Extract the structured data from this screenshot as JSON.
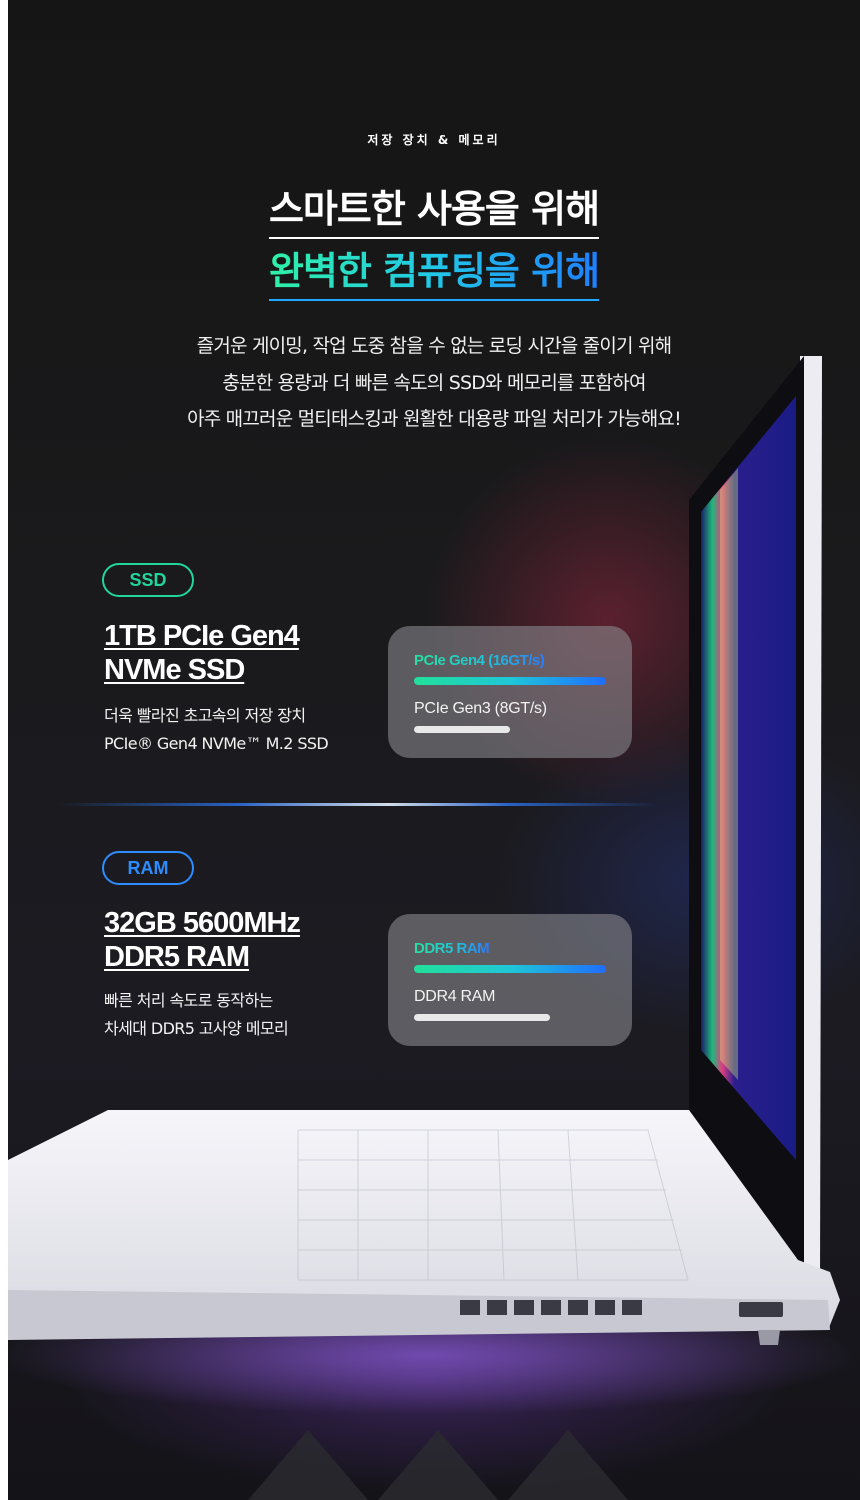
{
  "header": {
    "eyebrow": "저장 장치 & 메모리",
    "title_line1": "스마트한 사용을 위해",
    "title_line2": "완벽한 컴퓨팅을 위해"
  },
  "description": {
    "line1": "즐거운 게이밍, 작업 도중 참을 수 없는 로딩 시간을 줄이기 위해",
    "line2": "충분한 용량과 더 빠른 속도의 SSD와 메모리를 포함하여",
    "line3": "아주 매끄러운 멀티태스킹과 원활한 대용량 파일 처리가 가능해요!"
  },
  "ssd": {
    "badge": "SSD",
    "title_line1": "1TB PCIe Gen4",
    "title_line2": "NVMe SSD",
    "sub_line1": "더욱 빨라진 초고속의 저장 장치",
    "sub_line2": "PCIe® Gen4 NVMe™ M.2 SSD",
    "card": {
      "high_label": "PCIe Gen4 (16GT/s)",
      "high_level": 1.0,
      "low_label": "PCIe Gen3 (8GT/s)",
      "low_level": 0.5
    }
  },
  "ram": {
    "badge": "RAM",
    "title_line1": "32GB 5600MHz",
    "title_line2": "DDR5 RAM",
    "sub_line1": "빠른 처리 속도로 동작하는",
    "sub_line2": "차세대 DDR5 고사양 메모리",
    "card": {
      "high_label": "DDR5 RAM",
      "high_level": 1.0,
      "low_label": "DDR4 RAM",
      "low_level": 0.71
    }
  },
  "colors": {
    "ssd_accent": "#22d69a",
    "ram_accent": "#2d8cff",
    "background": "#1a1a1c"
  }
}
